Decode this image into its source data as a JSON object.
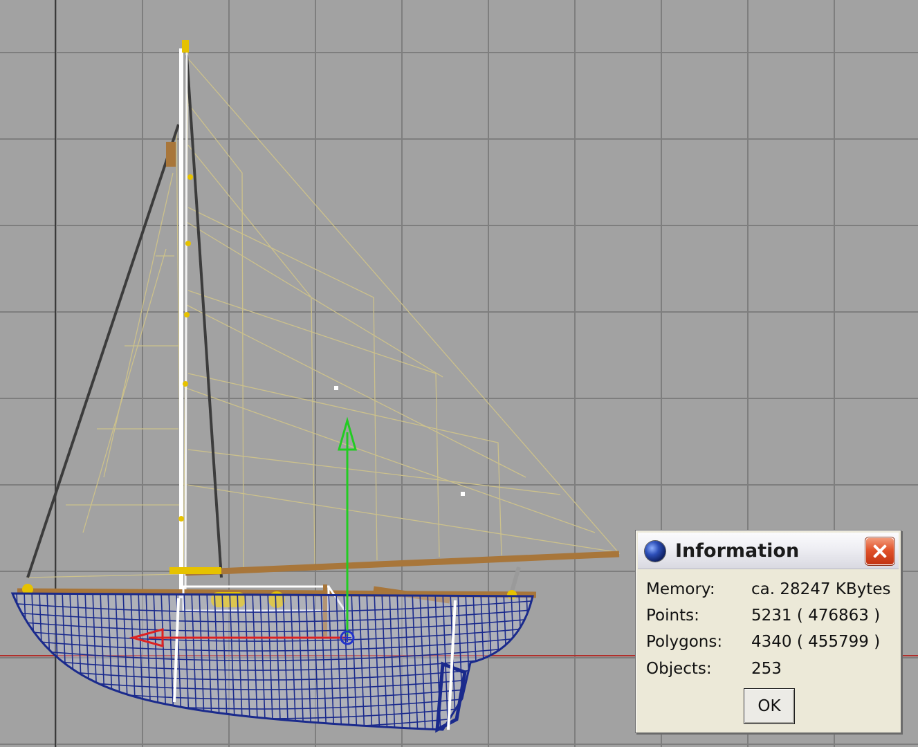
{
  "dialog": {
    "title": "Information",
    "rows": [
      {
        "label": "Memory:",
        "value": "ca. 28247 KBytes"
      },
      {
        "label": "Points:",
        "value": "5231 ( 476863 )"
      },
      {
        "label": "Polygons:",
        "value": "4340 ( 455799 )"
      },
      {
        "label": "Objects:",
        "value": "253"
      }
    ],
    "ok_label": "OK"
  },
  "colors": {
    "viewport_background": "#a2a2a2",
    "grid_line": "#7e7e7e",
    "hull_wireframe": "#1a2a8c",
    "sail_wireframe": "#cfc38a",
    "boom_wood": "#a8763a",
    "y_axis_gizmo": "#22cc22",
    "x_axis_gizmo": "#dd2222",
    "ground_line": "#b0302c"
  },
  "icons": [
    "app-sphere-icon",
    "close-icon"
  ]
}
